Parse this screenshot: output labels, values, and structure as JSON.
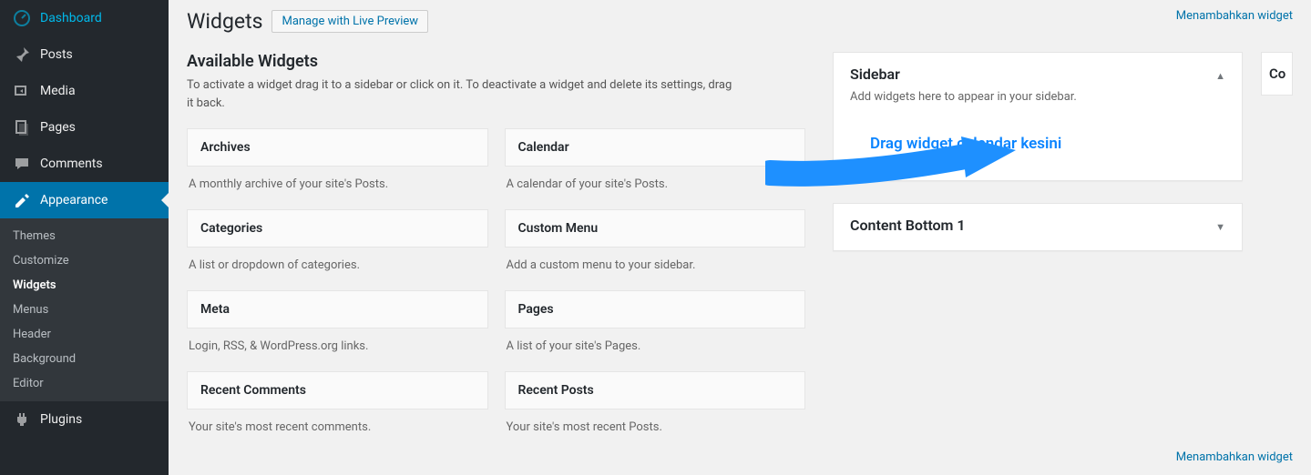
{
  "nav": {
    "dashboard": "Dashboard",
    "posts": "Posts",
    "media": "Media",
    "pages": "Pages",
    "comments": "Comments",
    "appearance": "Appearance",
    "plugins": "Plugins"
  },
  "submenu": {
    "themes": "Themes",
    "customize": "Customize",
    "widgets": "Widgets",
    "menus": "Menus",
    "header": "Header",
    "background": "Background",
    "editor": "Editor"
  },
  "header": {
    "title": "Widgets",
    "action": "Manage with Live Preview",
    "screen_link": "Menambahkan widget"
  },
  "available": {
    "title": "Available Widgets",
    "desc": "To activate a widget drag it to a sidebar or click on it. To deactivate a widget and delete its settings, drag it back."
  },
  "widgets": [
    {
      "title": "Archives",
      "desc": "A monthly archive of your site's Posts."
    },
    {
      "title": "Calendar",
      "desc": "A calendar of your site's Posts."
    },
    {
      "title": "Categories",
      "desc": "A list or dropdown of categories."
    },
    {
      "title": "Custom Menu",
      "desc": "Add a custom menu to your sidebar."
    },
    {
      "title": "Meta",
      "desc": "Login, RSS, & WordPress.org links."
    },
    {
      "title": "Pages",
      "desc": "A list of your site's Pages."
    },
    {
      "title": "Recent Comments",
      "desc": "Your site's most recent comments."
    },
    {
      "title": "Recent Posts",
      "desc": "Your site's most recent Posts."
    }
  ],
  "areas": {
    "sidebar": {
      "title": "Sidebar",
      "desc": "Add widgets here to appear in your sidebar.",
      "hint": "Drag widget calendar kesini"
    },
    "content_bottom": {
      "title": "Content Bottom 1"
    },
    "extra": {
      "title": "Co"
    }
  },
  "bottom_link": "Menambahkan widget"
}
